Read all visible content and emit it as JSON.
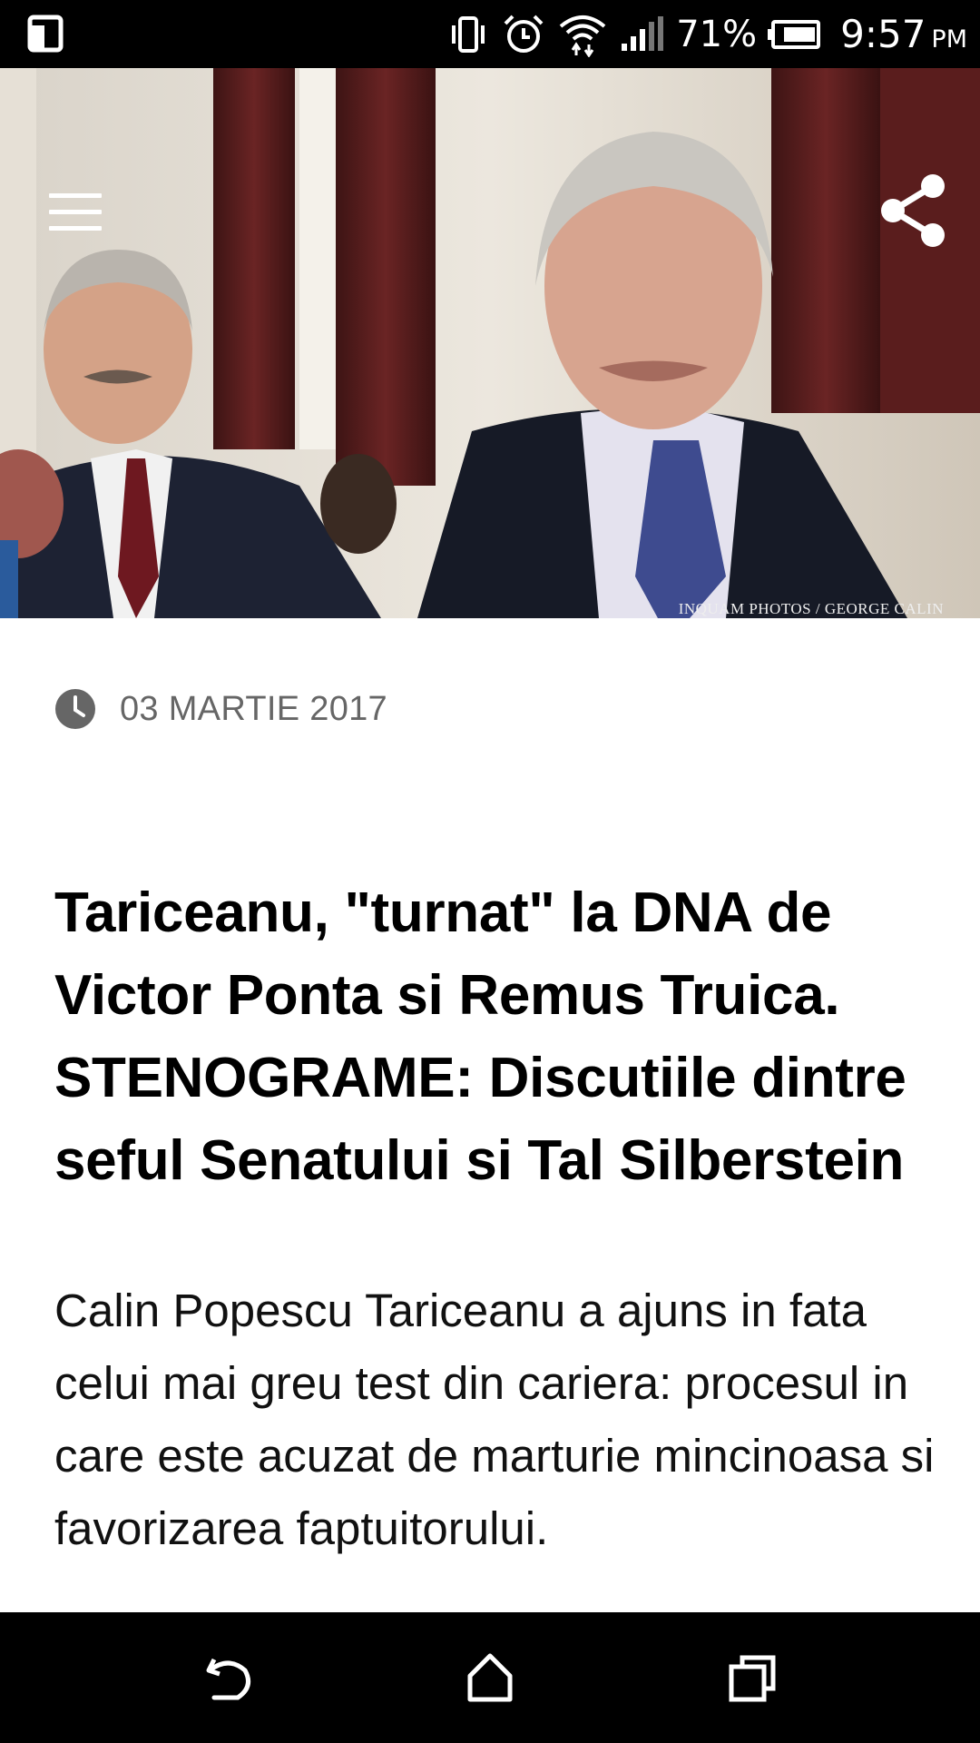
{
  "status_bar": {
    "battery_percent": "71%",
    "time": "9:57",
    "ampm": "PM",
    "icons": [
      "multi-window-icon",
      "vibrate-icon",
      "alarm-icon",
      "wifi-icon",
      "signal-icon",
      "battery-icon"
    ]
  },
  "hero": {
    "photo_credit": "INQUAM PHOTOS / GEORGE CALIN",
    "menu_icon": "hamburger-menu-icon",
    "share_icon": "share-icon"
  },
  "article": {
    "date": "03 MARTIE 2017",
    "title": "Tariceanu, \"turnat\" la DNA de Victor Ponta si Remus Truica. STENOGRAME: Discutiile dintre seful Senatului si Tal Silberstein",
    "lead": "Calin Popescu Tariceanu a ajuns in fata celui mai greu test din cariera: procesul in care este acuzat de marturie mincinoasa si favorizarea faptuitorului."
  },
  "nav": {
    "icons": [
      "back-icon",
      "home-icon",
      "recents-icon"
    ]
  },
  "colors": {
    "background": "#ffffff",
    "bars": "#000000",
    "date_text": "#666666",
    "title_text": "#000000"
  }
}
